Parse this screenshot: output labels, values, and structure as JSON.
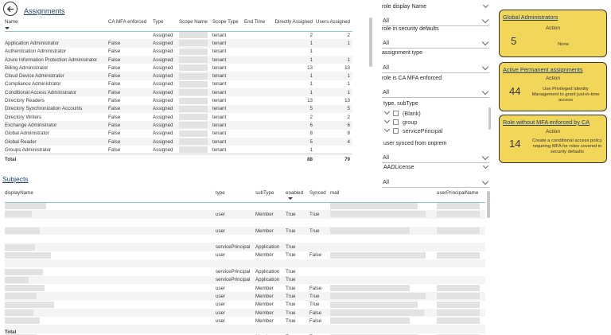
{
  "header": {
    "title": "Assignments"
  },
  "assignments": {
    "columns": [
      "Name",
      "CA MFA enforced",
      "Type",
      "Scope Name",
      "Scope Type",
      "End Time",
      "Directly Assigned",
      "Users Assigned"
    ],
    "rows": [
      [
        "",
        "",
        "Assigned",
        "",
        "tenant",
        "",
        "2",
        "2"
      ],
      [
        "Application Administrator",
        "False",
        "Assigned",
        "",
        "tenant",
        "",
        "1",
        "1"
      ],
      [
        "Authentication Administrator",
        "False",
        "Assigned",
        "",
        "tenant",
        "",
        "1",
        ""
      ],
      [
        "Azure Information Protection Administrator",
        "False",
        "Assigned",
        "",
        "tenant",
        "",
        "1",
        "1"
      ],
      [
        "Billing Administrator",
        "False",
        "Assigned",
        "",
        "tenant",
        "",
        "13",
        "13"
      ],
      [
        "Cloud Device Administrator",
        "False",
        "Assigned",
        "",
        "tenant",
        "",
        "1",
        "1"
      ],
      [
        "Compliance Administrator",
        "False",
        "Assigned",
        "",
        "tenant",
        "",
        "1",
        "1"
      ],
      [
        "Conditional Access Administrator",
        "False",
        "Assigned",
        "",
        "tenant",
        "",
        "1",
        "1"
      ],
      [
        "Directory Readers",
        "False",
        "Assigned",
        "",
        "tenant",
        "",
        "13",
        "13"
      ],
      [
        "Directory Synchronization Accounts",
        "False",
        "Assigned",
        "",
        "tenant",
        "",
        "5",
        "5"
      ],
      [
        "Directory Writers",
        "False",
        "Assigned",
        "",
        "tenant",
        "",
        "2",
        "2"
      ],
      [
        "Exchange Administrator",
        "False",
        "Assigned",
        "",
        "tenant",
        "",
        "6",
        "6"
      ],
      [
        "Global Administrator",
        "False",
        "Assigned",
        "",
        "tenant",
        "",
        "8",
        "8"
      ],
      [
        "Global Reader",
        "False",
        "Assigned",
        "",
        "tenant",
        "",
        "5",
        "4"
      ],
      [
        "Groups Administrator",
        "False",
        "Assigned",
        "",
        "tenant",
        "",
        "1",
        ""
      ]
    ],
    "total_label": "Total",
    "total_directly": "88",
    "total_users": "79"
  },
  "subjects": {
    "title": "Subjects",
    "columns": [
      "displayName",
      "type",
      "subType",
      "enabled",
      "Synced",
      "mail",
      "userPrincipalName"
    ],
    "rows": [
      [
        "",
        "",
        "",
        "",
        "",
        "",
        ""
      ],
      [
        "",
        "user",
        "Member",
        "True",
        "True",
        "",
        ""
      ],
      [
        "",
        "",
        "",
        "",
        "",
        "",
        ""
      ],
      [
        "",
        "user",
        "Member",
        "True",
        "True",
        "",
        ""
      ],
      [
        "",
        "",
        "",
        "",
        "",
        "",
        ""
      ],
      [
        "",
        "servicePrincipal",
        "Application",
        "True",
        "",
        "",
        ""
      ],
      [
        "",
        "user",
        "Member",
        "True",
        "False",
        "",
        ""
      ],
      [
        "",
        "",
        "",
        "",
        "",
        "",
        ""
      ],
      [
        "",
        "servicePrincipal",
        "Application",
        "True",
        "",
        "",
        ""
      ],
      [
        "",
        "servicePrincipal",
        "Application",
        "True",
        "",
        "",
        ""
      ],
      [
        "",
        "user",
        "Member",
        "True",
        "False",
        "",
        ""
      ],
      [
        "",
        "user",
        "Member",
        "True",
        "True",
        "",
        ""
      ],
      [
        "",
        "user",
        "Member",
        "True",
        "True",
        "",
        ""
      ],
      [
        "",
        "user",
        "Member",
        "True",
        "False",
        "",
        ""
      ],
      [
        "",
        "user",
        "Member",
        "True",
        "False",
        "",
        ""
      ],
      [
        "",
        "",
        "",
        "",
        "",
        "",
        ""
      ],
      [
        "",
        "user",
        "Member",
        "True",
        "True",
        "",
        ""
      ]
    ],
    "total_label": "Total"
  },
  "slicers": {
    "role_display_name": {
      "title": "role display Name",
      "value": "All"
    },
    "role_in_security_defaults": {
      "title": "role in security defaults",
      "value": "All"
    },
    "assignment_type": {
      "title": "assignment type",
      "value": "All"
    },
    "role_is_ca_mfa_enforced": {
      "title": "role is CA MFA enforced",
      "value": "All"
    },
    "type_subtype": {
      "title": "type, subType",
      "items": [
        "(Blank)",
        "group",
        "servicePrincipal"
      ]
    },
    "user_synced": {
      "title": "user synced from onprem",
      "value": "All"
    },
    "aad_license": {
      "title": "AADLicense",
      "value": "All"
    }
  },
  "cards": [
    {
      "title": "Global Administrators",
      "label": "Action",
      "number": "5",
      "desc": "None"
    },
    {
      "title": "Active Permanent assignments",
      "label": "Action",
      "number": "44",
      "desc": "Use Privileged Identity Management to grant just-in-time access"
    },
    {
      "title": "Role without MFA enforced by CA",
      "label": "Action",
      "number": "14",
      "desc": "Create a conditional access policy requiring MFA for roles covered in security defaults"
    }
  ],
  "colors": {
    "accent_line": "#8ec9c5",
    "card_bg": "#f2d65a",
    "title_link": "#1f3f6e"
  },
  "icons": {
    "back": "back-arrow-icon"
  }
}
